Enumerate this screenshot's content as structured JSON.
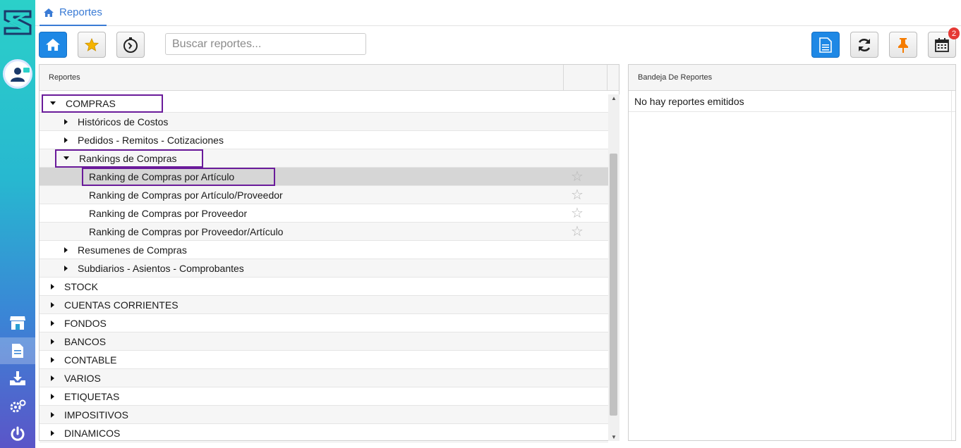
{
  "app": {
    "breadcrumb": "Reportes",
    "notification_count": "2"
  },
  "toolbar": {
    "search_placeholder": "Buscar reportes..."
  },
  "reports_panel": {
    "header": "Reportes",
    "tree": [
      {
        "label": "COMPRAS",
        "level": 0,
        "state": "expanded",
        "highlight": true
      },
      {
        "label": "Históricos de Costos",
        "level": 1,
        "state": "collapsed"
      },
      {
        "label": "Pedidos - Remitos - Cotizaciones",
        "level": 1,
        "state": "collapsed"
      },
      {
        "label": "Rankings de Compras",
        "level": 1,
        "state": "expanded",
        "highlight": true
      },
      {
        "label": "Ranking de Compras por Artículo",
        "level": 2,
        "state": "leaf",
        "selected": true,
        "highlight": true
      },
      {
        "label": "Ranking de Compras por Artículo/Proveedor",
        "level": 2,
        "state": "leaf"
      },
      {
        "label": "Ranking de Compras por Proveedor",
        "level": 2,
        "state": "leaf"
      },
      {
        "label": "Ranking de Compras por Proveedor/Artículo",
        "level": 2,
        "state": "leaf"
      },
      {
        "label": "Resumenes de Compras",
        "level": 1,
        "state": "collapsed"
      },
      {
        "label": "Subdiarios - Asientos - Comprobantes",
        "level": 1,
        "state": "collapsed"
      },
      {
        "label": "STOCK",
        "level": 0,
        "state": "collapsed"
      },
      {
        "label": "CUENTAS CORRIENTES",
        "level": 0,
        "state": "collapsed"
      },
      {
        "label": "FONDOS",
        "level": 0,
        "state": "collapsed"
      },
      {
        "label": "BANCOS",
        "level": 0,
        "state": "collapsed"
      },
      {
        "label": "CONTABLE",
        "level": 0,
        "state": "collapsed"
      },
      {
        "label": "VARIOS",
        "level": 0,
        "state": "collapsed"
      },
      {
        "label": "ETIQUETAS",
        "level": 0,
        "state": "collapsed"
      },
      {
        "label": "IMPOSITIVOS",
        "level": 0,
        "state": "collapsed"
      },
      {
        "label": "DINAMICOS",
        "level": 0,
        "state": "collapsed"
      }
    ]
  },
  "tray_panel": {
    "header": "Bandeja De Reportes",
    "empty_text": "No hay reportes emitidos"
  },
  "colors": {
    "accent": "#1e88e5",
    "breadcrumb": "#3a7bd5",
    "highlight_box": "#6a1b9a",
    "pin": "#f57c00",
    "badge": "#e53935"
  }
}
